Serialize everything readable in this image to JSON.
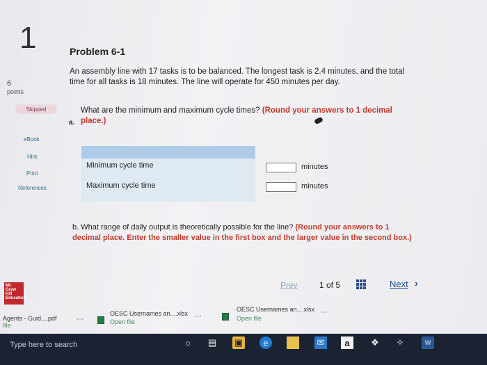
{
  "question": {
    "number": "1",
    "points_value": "6",
    "points_label": "points",
    "status_badge": "Skipped"
  },
  "sidebar": {
    "items": [
      {
        "label": "eBook"
      },
      {
        "label": "Hint"
      },
      {
        "label": "Print"
      },
      {
        "label": "References"
      }
    ]
  },
  "problem": {
    "title": "Problem 6-1",
    "text": "An assembly line with 17 tasks is to be balanced. The longest task is 2.4 minutes, and the total time for all tasks is 18 minutes. The line will operate for 450 minutes per day."
  },
  "part_a": {
    "letter": "a.",
    "question": "What are the minimum and maximum cycle times?",
    "instruction": "(Round your answers to 1 decimal place.)",
    "rows": [
      {
        "label": "Minimum cycle time",
        "value": "",
        "unit": "minutes"
      },
      {
        "label": "Maximum cycle time",
        "value": "",
        "unit": "minutes"
      }
    ]
  },
  "part_b": {
    "question": "b. What range of daily output is theoretically possible for the line?",
    "instruction": "(Round your answers to 1 decimal place. Enter the smaller value in the first box and the larger value in the second box.)"
  },
  "publisher_logo": "Mc Graw Hill Education",
  "nav": {
    "prev_label": "Prev",
    "page_current": "1",
    "page_of": "of",
    "page_total": "5",
    "next_label": "Next"
  },
  "downloads": [
    {
      "name": "Agents - Guid....pdf",
      "sub": "file"
    },
    {
      "name": "OESC Usernames an....xlsx",
      "sub": "Open file"
    },
    {
      "name": "OESC Usernames an....xlsx",
      "sub": "Open file"
    }
  ],
  "taskbar": {
    "search_placeholder": "Type here to search",
    "icons": [
      "cortana-icon",
      "task-view-icon",
      "store-icon",
      "edge-icon",
      "file-explorer-icon",
      "mail-icon",
      "amazon-icon",
      "dropbox-icon",
      "arrow-app-icon",
      "word-icon"
    ]
  },
  "colors": {
    "accent_red": "#c0392b",
    "link_blue": "#1f4f8c",
    "table_header": "#aeccea",
    "badge_bg": "#ecd8dc"
  }
}
